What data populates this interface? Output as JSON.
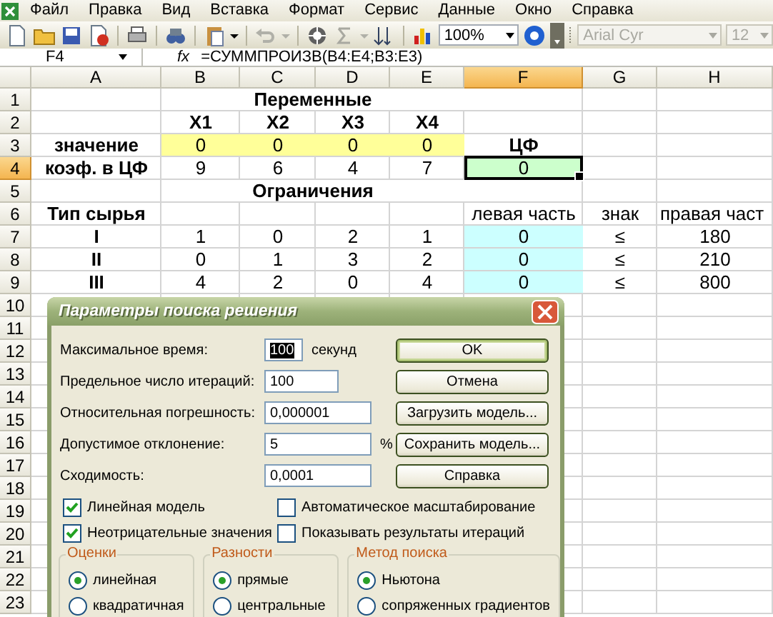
{
  "menu": {
    "items": [
      "Файл",
      "Правка",
      "Вид",
      "Вставка",
      "Формат",
      "Сервис",
      "Данные",
      "Окно",
      "Справка"
    ]
  },
  "toolbar": {
    "zoom": "100%",
    "font": {
      "value": "Arial Cyr",
      "disabled": true
    },
    "font_size": {
      "value": "12",
      "disabled": true
    }
  },
  "formula_bar": {
    "name_box": "F4",
    "function_label": "fx",
    "formula": "=СУММПРОИЗВ(B4:E4;B3:E3)"
  },
  "sheet": {
    "columns": [
      {
        "label": "A",
        "selected": false
      },
      {
        "label": "B",
        "selected": false
      },
      {
        "label": "C",
        "selected": false
      },
      {
        "label": "D",
        "selected": false
      },
      {
        "label": "E",
        "selected": false
      },
      {
        "label": "F",
        "selected": true
      },
      {
        "label": "G",
        "selected": false
      },
      {
        "label": "H",
        "selected": false
      }
    ],
    "rows": [
      {
        "number": "1",
        "selected": false,
        "cells": {
          "B": {
            "text": "Переменные",
            "kind": "title"
          }
        }
      },
      {
        "number": "2",
        "selected": false,
        "cells": {
          "B": {
            "text": "X1",
            "kind": "label"
          },
          "C": {
            "text": "X2",
            "kind": "label"
          },
          "D": {
            "text": "X3",
            "kind": "label"
          },
          "E": {
            "text": "X4",
            "kind": "label"
          }
        }
      },
      {
        "number": "3",
        "selected": false,
        "cells": {
          "A": {
            "text": "значение",
            "kind": "label"
          },
          "B": {
            "text": "0",
            "kind": "value",
            "color": "#ffff99"
          },
          "C": {
            "text": "0",
            "kind": "value",
            "color": "#ffff99"
          },
          "D": {
            "text": "0",
            "kind": "value",
            "color": "#ffff99"
          },
          "E": {
            "text": "0",
            "kind": "value",
            "color": "#ffff99"
          },
          "F": {
            "text": "ЦФ",
            "kind": "label"
          }
        }
      },
      {
        "number": "4",
        "selected": true,
        "cells": {
          "A": {
            "text": "коэф. в ЦФ",
            "kind": "label"
          },
          "B": {
            "text": "9",
            "kind": "value"
          },
          "C": {
            "text": "6",
            "kind": "value"
          },
          "D": {
            "text": "4",
            "kind": "value"
          },
          "E": {
            "text": "7",
            "kind": "value"
          },
          "F": {
            "text": "0",
            "kind": "value",
            "color": "#ccffcc"
          }
        }
      },
      {
        "number": "5",
        "selected": false,
        "cells": {
          "B": {
            "text": "Ограничения",
            "kind": "title"
          }
        }
      },
      {
        "number": "6",
        "selected": false,
        "cells": {
          "A": {
            "text": "Тип сырья",
            "kind": "label"
          },
          "F": {
            "text": "левая часть",
            "kind": "value"
          },
          "G": {
            "text": "знак",
            "kind": "value"
          },
          "H": {
            "text": "правая част",
            "kind": "text"
          }
        }
      },
      {
        "number": "7",
        "selected": false,
        "cells": {
          "A": {
            "text": "I",
            "kind": "label"
          },
          "B": {
            "text": "1",
            "kind": "value"
          },
          "C": {
            "text": "0",
            "kind": "value"
          },
          "D": {
            "text": "2",
            "kind": "value"
          },
          "E": {
            "text": "1",
            "kind": "value"
          },
          "F": {
            "text": "0",
            "kind": "value",
            "color": "#ccffff"
          },
          "G": {
            "text": "≤",
            "kind": "value"
          },
          "H": {
            "text": "180",
            "kind": "value"
          }
        }
      },
      {
        "number": "8",
        "selected": false,
        "cells": {
          "A": {
            "text": "II",
            "kind": "label"
          },
          "B": {
            "text": "0",
            "kind": "value"
          },
          "C": {
            "text": "1",
            "kind": "value"
          },
          "D": {
            "text": "3",
            "kind": "value"
          },
          "E": {
            "text": "2",
            "kind": "value"
          },
          "F": {
            "text": "0",
            "kind": "value",
            "color": "#ccffff"
          },
          "G": {
            "text": "≤",
            "kind": "value"
          },
          "H": {
            "text": "210",
            "kind": "value"
          }
        }
      },
      {
        "number": "9",
        "selected": false,
        "cells": {
          "A": {
            "text": "III",
            "kind": "label"
          },
          "B": {
            "text": "4",
            "kind": "value"
          },
          "C": {
            "text": "2",
            "kind": "value"
          },
          "D": {
            "text": "0",
            "kind": "value"
          },
          "E": {
            "text": "4",
            "kind": "value"
          },
          "F": {
            "text": "0",
            "kind": "value",
            "color": "#ccffff"
          },
          "G": {
            "text": "≤",
            "kind": "value"
          },
          "H": {
            "text": "800",
            "kind": "value"
          }
        }
      },
      {
        "number": "10",
        "selected": false,
        "cells": {}
      },
      {
        "number": "11",
        "selected": false,
        "cells": {}
      },
      {
        "number": "12",
        "selected": false,
        "cells": {}
      },
      {
        "number": "13",
        "selected": false,
        "cells": {}
      },
      {
        "number": "14",
        "selected": false,
        "cells": {}
      },
      {
        "number": "15",
        "selected": false,
        "cells": {}
      },
      {
        "number": "16",
        "selected": false,
        "cells": {}
      },
      {
        "number": "17",
        "selected": false,
        "cells": {}
      },
      {
        "number": "18",
        "selected": false,
        "cells": {}
      },
      {
        "number": "19",
        "selected": false,
        "cells": {}
      },
      {
        "number": "20",
        "selected": false,
        "cells": {}
      },
      {
        "number": "21",
        "selected": false,
        "cells": {}
      },
      {
        "number": "22",
        "selected": false,
        "cells": {}
      },
      {
        "number": "23",
        "selected": false,
        "cells": {}
      }
    ]
  },
  "dialog": {
    "title": "Параметры поиска решения",
    "fields": [
      {
        "label": "Максимальное время:",
        "value": "100",
        "suffix": "секунд",
        "focused": true
      },
      {
        "label": "Предельное число итераций:",
        "value": "100",
        "focused": false
      },
      {
        "label": "Относительная погрешность:",
        "value": "0,000001",
        "focused": false
      },
      {
        "label": "Допустимое отклонение:",
        "value": "5",
        "suffix": "%",
        "focused": false
      },
      {
        "label": "Сходимость:",
        "value": "0,0001",
        "focused": false
      }
    ],
    "buttons": [
      {
        "label": "OK",
        "default": true
      },
      {
        "label": "Отмена",
        "default": false
      },
      {
        "label": "Загрузить модель...",
        "default": false
      },
      {
        "label": "Сохранить модель...",
        "default": false
      },
      {
        "label": "Справка",
        "default": false
      }
    ],
    "checkboxes": [
      {
        "label": "Линейная модель",
        "checked": true
      },
      {
        "label": "Автоматическое масштабирование",
        "checked": false
      },
      {
        "label": "Неотрицательные значения",
        "checked": true
      },
      {
        "label": "Показывать результаты итераций",
        "checked": false
      }
    ],
    "groups": [
      {
        "title": "Оценки",
        "options": [
          {
            "label": "линейная",
            "selected": true
          },
          {
            "label": "квадратичная",
            "selected": false
          }
        ]
      },
      {
        "title": "Разности",
        "options": [
          {
            "label": "прямые",
            "selected": true
          },
          {
            "label": "центральные",
            "selected": false
          }
        ]
      },
      {
        "title": "Метод поиска",
        "options": [
          {
            "label": "Ньютона",
            "selected": true
          },
          {
            "label": "сопряженных градиентов",
            "selected": false
          }
        ]
      }
    ]
  }
}
